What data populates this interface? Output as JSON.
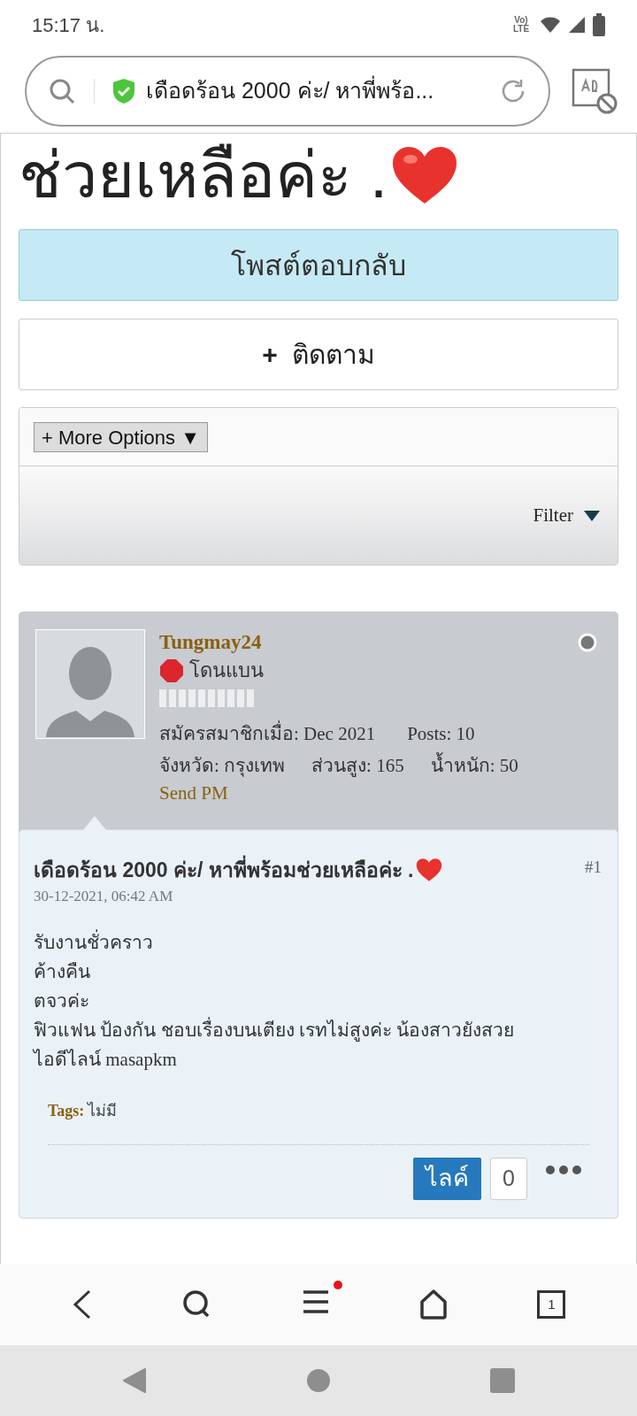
{
  "status_bar": {
    "time": "15:17 น.",
    "network": "Vo) LTE"
  },
  "address_bar": {
    "title": "เดือดร้อน 2000 ค่ะ/ หาพี่พร้อ..."
  },
  "page_title": "ช่วยเหลือค่ะ .",
  "reply_button": "โพสต์ตอบกลับ",
  "follow_button": {
    "icon": "+",
    "label": "ติดตาม"
  },
  "more_options": "+ More Options ▼",
  "filter": "Filter",
  "post": {
    "username": "Tungmay24",
    "status": "โดนแบน",
    "info": [
      [
        "สมัครสมาชิกเมื่อ: Dec 2021",
        "Posts: 10"
      ],
      [
        "จังหวัด: กรุงเทพ",
        "ส่วนสูง: 165",
        "น้ำหนัก: 50"
      ]
    ],
    "send_pm": "Send PM",
    "title": "เดือดร้อน 2000 ค่ะ/ หาพี่พร้อมช่วยเหลือค่ะ .",
    "number": "#1",
    "date": "30-12-2021, 06:42 AM",
    "body": [
      "รับงานชั่วคราว",
      "ค้างคืน",
      "ตจวค่ะ",
      "ฟิวแฟน ป้องกัน ชอบเรื่องบนเตียง เรทไม่สูงค่ะ น้องสาวยังสวย",
      "ไอดีไลน์ masapkm"
    ],
    "tags_label": "Tags:",
    "tags": "ไม่มี",
    "like_label": "ไลค์",
    "like_count": "0"
  },
  "bottom_nav": {
    "tab_count": "1",
    "menu_badge": true
  }
}
